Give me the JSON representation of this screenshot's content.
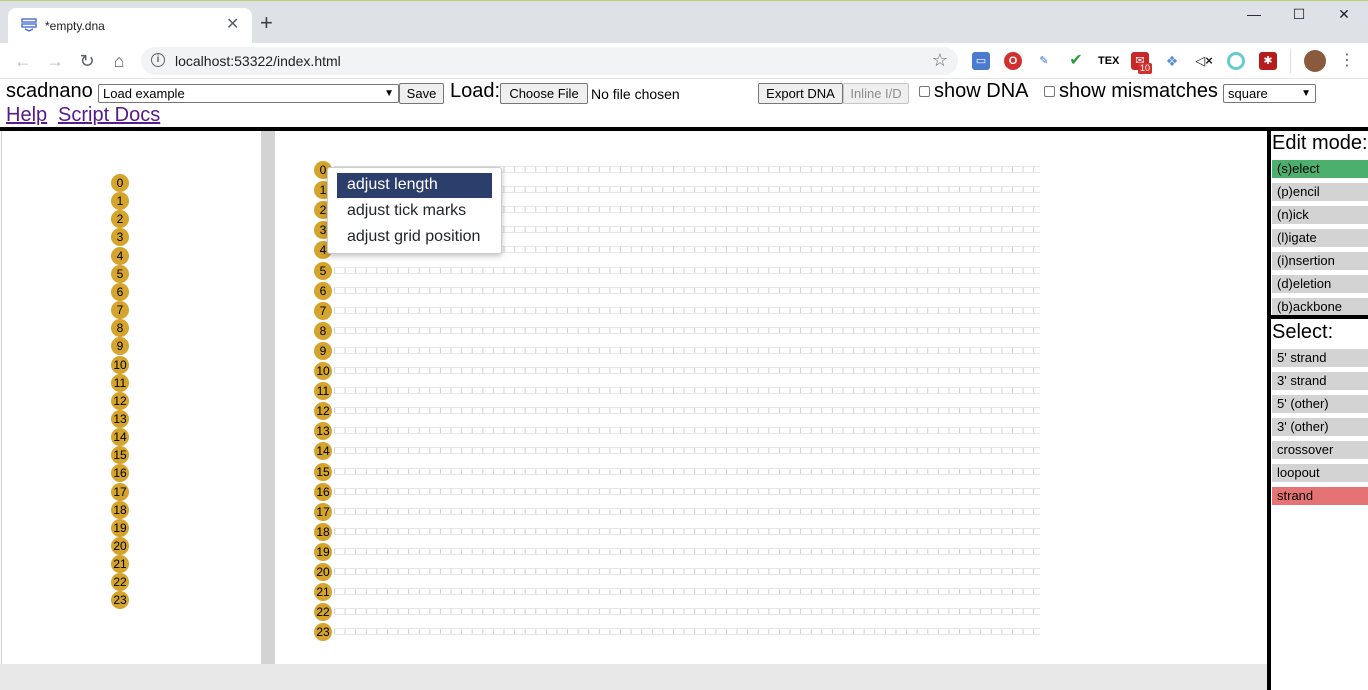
{
  "browser": {
    "tab_title": "*empty.dna",
    "url": "localhost:53322/index.html",
    "new_tab": "+",
    "close": "✕",
    "minimize": "—",
    "maximize": "☐",
    "win_close": "✕",
    "ext_gmail_badge": "10"
  },
  "menu": {
    "app_name": "scadnano",
    "load_example": "Load example",
    "save": "Save",
    "load_label": "Load:",
    "choose_file": "Choose File",
    "no_file": "No file chosen",
    "export_dna": "Export DNA",
    "inline_id": "Inline I/D",
    "show_dna": "show DNA",
    "show_mismatches": "show mismatches",
    "grid_select": "square",
    "help": "Help",
    "script_docs": "Script Docs"
  },
  "helices": [
    "0",
    "1",
    "2",
    "3",
    "4",
    "5",
    "6",
    "7",
    "8",
    "9",
    "10",
    "11",
    "12",
    "13",
    "14",
    "15",
    "16",
    "17",
    "18",
    "19",
    "20",
    "21",
    "22",
    "23"
  ],
  "context_menu": {
    "items": [
      "adjust length",
      "adjust tick marks",
      "adjust grid position"
    ]
  },
  "edit_mode": {
    "title": "Edit mode:",
    "items": [
      "(s)elect",
      "(p)encil",
      "(n)ick",
      "(l)igate",
      "(i)nsertion",
      "(d)eletion",
      "(b)ackbone"
    ],
    "active_color": "#4caf6e"
  },
  "select_mode": {
    "title": "Select:",
    "items": [
      "5' strand",
      "3' strand",
      "5' (other)",
      "3' (other)",
      "crossover",
      "loopout",
      "strand"
    ],
    "active_color": "#e57373"
  },
  "colors": {
    "helix": "#d4a42c",
    "ctx_active": "#2c3e6b"
  }
}
